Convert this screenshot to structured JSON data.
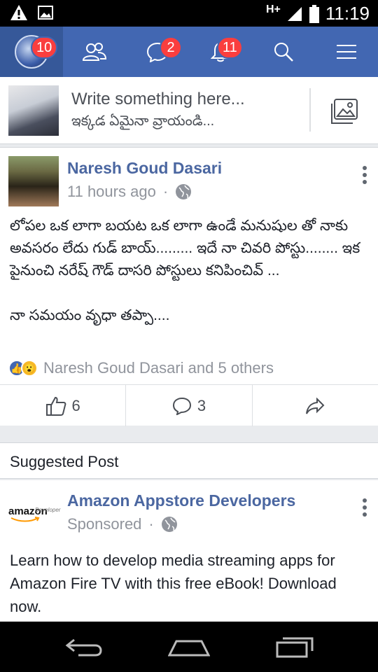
{
  "status_bar": {
    "network": "H+",
    "time": "11:19",
    "icons": [
      "warning-icon",
      "image-icon",
      "signal-icon",
      "battery-icon"
    ]
  },
  "nav": {
    "profile_badge": "10",
    "friends_icon": "friends-icon",
    "messages_badge": "2",
    "notifications_badge": "11",
    "search_icon": "search-icon",
    "menu_icon": "menu-icon"
  },
  "composer": {
    "placeholder_en": "Write something here...",
    "placeholder_te": "ఇక్కడ ఏమైనా వ్రాయండి..."
  },
  "post": {
    "author": "Naresh Goud Dasari",
    "time": "11 hours ago",
    "separator": "·",
    "body_lines": [
      "లోపల ఒక లాగా బయట ఒక లాగా ఉండే  మనుషుల తో నాకు అవసరం లేదు గుడ్ బాయ్......... ఇదే నా చివరి పోస్టు........ ఇక పైనుంచి నరేష్ గౌడ్ దాసరి పోస్టులు కనిపించివ్ ...",
      "నా సమయం వృధా తప్పా...."
    ],
    "reactions_text": "Naresh Goud Dasari and 5 others",
    "like_count": "6",
    "comment_count": "3"
  },
  "suggested_label": "Suggested Post",
  "ad": {
    "logo_text": "amazon",
    "logo_sub": "Developer",
    "author": "Amazon Appstore Developers",
    "sponsored": "Sponsored",
    "separator": "·",
    "body": "Learn how to develop media streaming apps for Amazon Fire TV with this free eBook! Download now."
  },
  "colors": {
    "brand_blue": "#4267b2",
    "badge_red": "#fa3e3e",
    "link_blue": "#4b67a1",
    "muted_gray": "#90949c"
  }
}
